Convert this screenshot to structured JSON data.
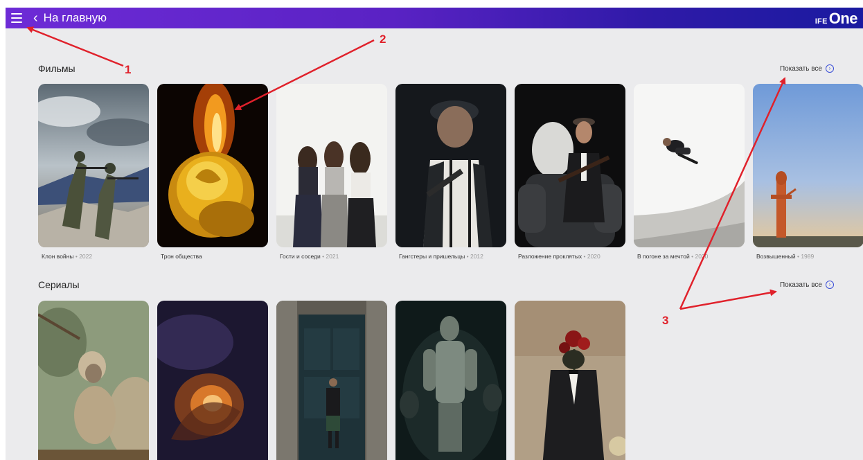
{
  "topbar": {
    "back_label": "На главную",
    "logo_prefix": "IFE",
    "logo_word": "One",
    "colors": {
      "gradient_start": "#6d2bd6",
      "gradient_end": "#1a1aa0"
    },
    "icons": {
      "menu": "hamburger-icon",
      "back": "chevron-left-icon"
    }
  },
  "movies": {
    "title": "Фильмы",
    "show_all": "Показать все",
    "items": [
      {
        "title": "Клон войны",
        "sep": " • ",
        "year": "2022"
      },
      {
        "title": "Трон общества",
        "sep": "",
        "year": ""
      },
      {
        "title": "Гости и соседи",
        "sep": " • ",
        "year": "2021"
      },
      {
        "title": "Гангстеры и пришельцы",
        "sep": " • ",
        "year": "2012"
      },
      {
        "title": "Разложение проклятых",
        "sep": " • ",
        "year": "2020"
      },
      {
        "title": "В погоне за мечтой",
        "sep": " • ",
        "year": "2020"
      },
      {
        "title": "Возвышенный",
        "sep": " • ",
        "year": "1989"
      }
    ]
  },
  "series": {
    "title": "Сериалы",
    "show_all": "Показать все"
  },
  "annotations": {
    "label_1": "1",
    "label_2": "2",
    "label_3": "3",
    "color": "#e0212b"
  }
}
